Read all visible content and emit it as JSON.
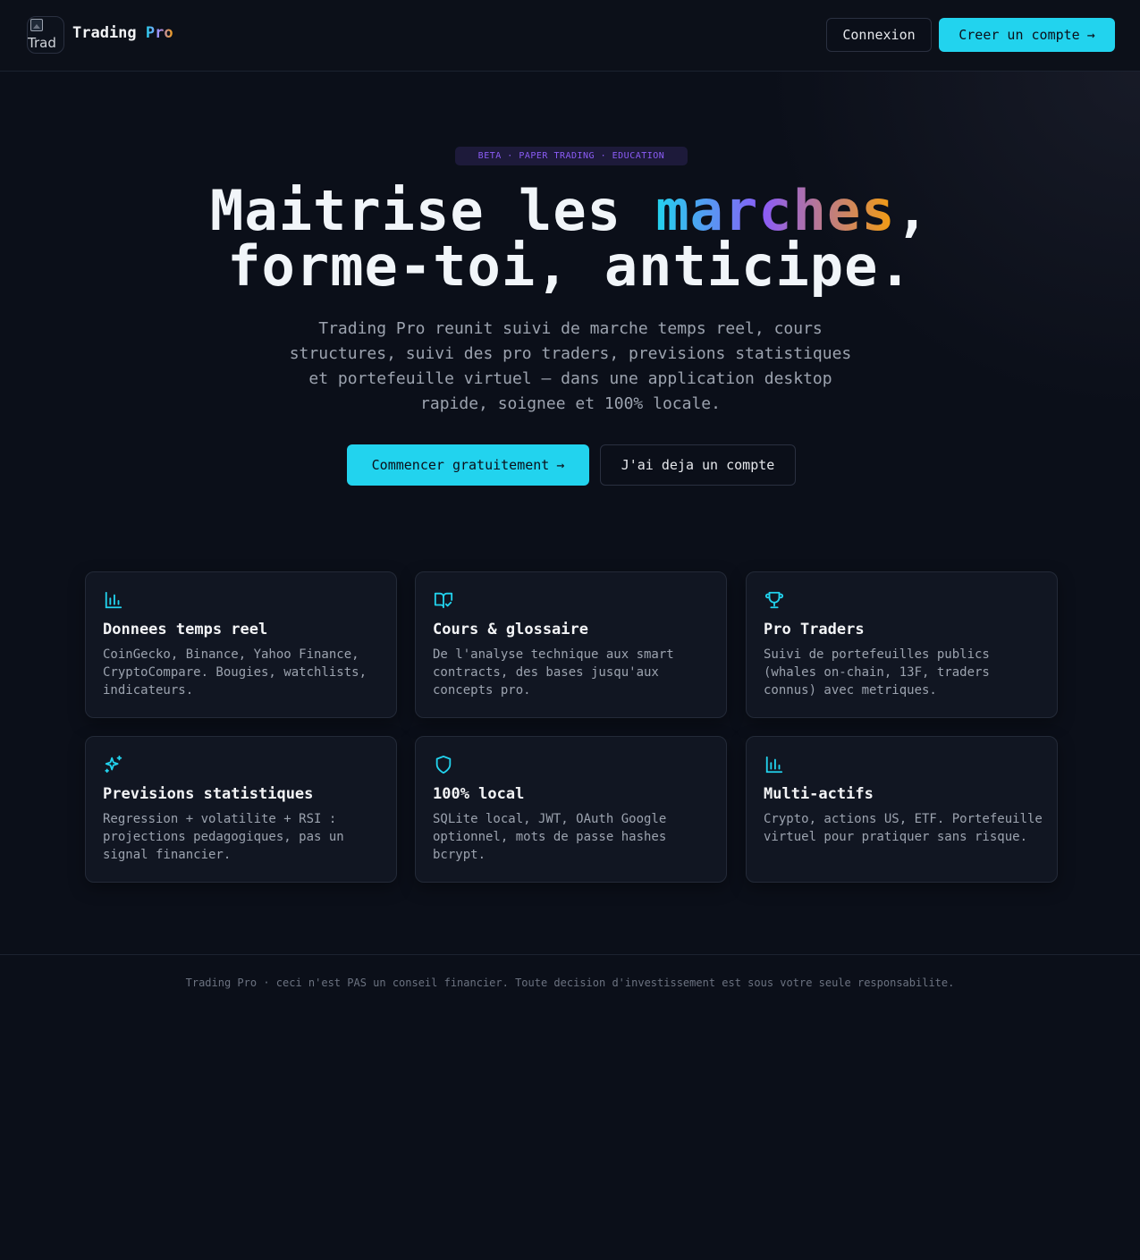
{
  "header": {
    "logo_alt": "Trad",
    "brand_main": "Trading",
    "brand_accent": "Pro",
    "login_label": "Connexion",
    "signup_label": "Creer un compte",
    "arrow": "→"
  },
  "hero": {
    "badge": "BETA · PAPER TRADING · EDUCATION",
    "title_line1_a": "Maitrise les ",
    "title_line1_grad": "marches",
    "title_line1_b": ",",
    "title_line2": "forme-toi, anticipe.",
    "description": "Trading Pro reunit suivi de marche temps reel, cours structures, suivi des pro traders, previsions statistiques et portefeuille virtuel — dans une application desktop rapide, soignee et 100% locale.",
    "cta_primary": "Commencer gratuitement",
    "cta_secondary": "J'ai deja un compte",
    "arrow": "→"
  },
  "features": [
    {
      "icon": "bar-chart-icon",
      "title": "Donnees temps reel",
      "description": "CoinGecko, Binance, Yahoo Finance, CryptoCompare. Bougies, watchlists, indicateurs."
    },
    {
      "icon": "book-check-icon",
      "title": "Cours & glossaire",
      "description": "De l'analyse technique aux smart contracts, des bases jusqu'aux concepts pro."
    },
    {
      "icon": "trophy-icon",
      "title": "Pro Traders",
      "description": "Suivi de portefeuilles publics (whales on-chain, 13F, traders connus) avec metriques."
    },
    {
      "icon": "sparkles-icon",
      "title": "Previsions statistiques",
      "description": "Regression + volatilite + RSI : projections pedagogiques, pas un signal financier."
    },
    {
      "icon": "shield-icon",
      "title": "100% local",
      "description": "SQLite local, JWT, OAuth Google optionnel, mots de passe hashes bcrypt."
    },
    {
      "icon": "bar-chart-icon",
      "title": "Multi-actifs",
      "description": "Crypto, actions US, ETF. Portefeuille virtuel pour pratiquer sans risque."
    }
  ],
  "footer": {
    "text": "Trading Pro · ceci n'est PAS un conseil financier. Toute decision d'investissement est sous votre seule responsabilite."
  },
  "colors": {
    "background": "#0b0f19",
    "accent_cyan": "#22d3ee",
    "accent_purple": "#8b5cf6",
    "accent_orange": "#f59e0b"
  }
}
